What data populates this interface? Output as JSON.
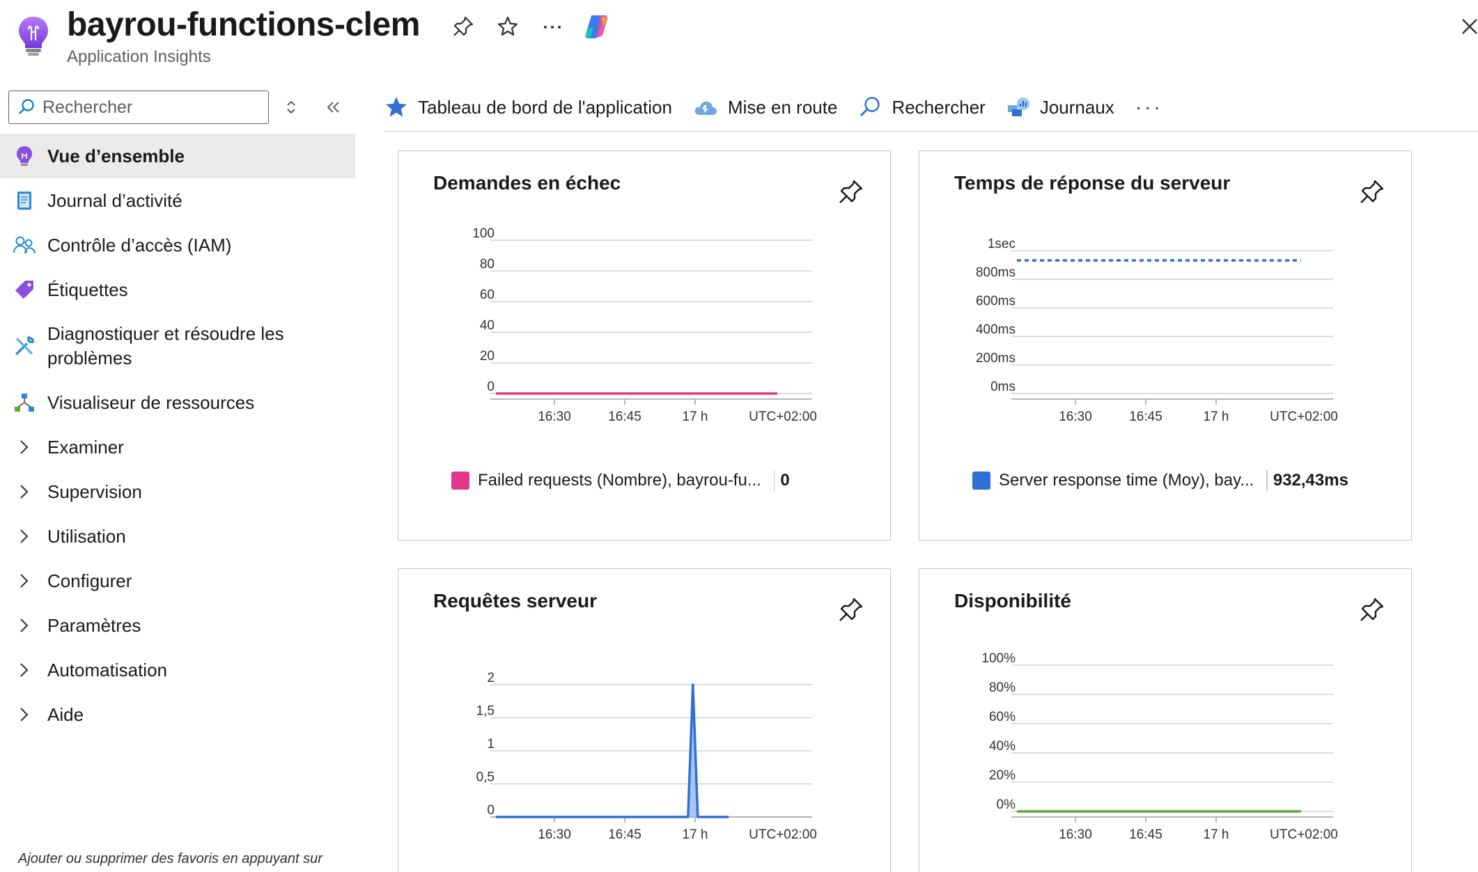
{
  "header": {
    "title": "bayrou-functions-clem",
    "subtitle": "Application Insights"
  },
  "sidebar": {
    "search_placeholder": "Rechercher",
    "items": [
      {
        "label": "Vue d’ensemble",
        "icon": "lightbulb-icon",
        "active": true
      },
      {
        "label": "Journal d’activité",
        "icon": "log-book-icon"
      },
      {
        "label": "Contrôle d’accès (IAM)",
        "icon": "people-icon"
      },
      {
        "label": "Étiquettes",
        "icon": "tag-icon"
      },
      {
        "label": "Diagnostiquer et résoudre les problèmes",
        "icon": "wrench-icon"
      },
      {
        "label": "Visualiseur de ressources",
        "icon": "hierarchy-icon"
      }
    ],
    "groups": [
      "Examiner",
      "Supervision",
      "Utilisation",
      "Configurer",
      "Paramètres",
      "Automatisation",
      "Aide"
    ],
    "footer_hint": "Ajouter ou supprimer des favoris en appuyant sur"
  },
  "toolbar": {
    "items": [
      {
        "label": "Tableau de bord de l'application",
        "icon": "star-icon"
      },
      {
        "label": "Mise en route",
        "icon": "cloud-icon"
      },
      {
        "label": "Rechercher",
        "icon": "search-icon"
      },
      {
        "label": "Journaux",
        "icon": "logs-icon"
      }
    ],
    "more": "···"
  },
  "colors": {
    "accent": "#0078d4",
    "failed": "#e3378a",
    "response": "#2f6fd6",
    "requests": "#2f6fd6",
    "availability": "#5ea72f",
    "active_bg": "#edebe9"
  },
  "chart_data": [
    {
      "type": "line",
      "title": "Demandes en échec",
      "x_ticks": [
        "16:30",
        "16:45",
        "17 h",
        "UTC+02:00"
      ],
      "y_ticks": [
        "100",
        "80",
        "60",
        "40",
        "20",
        "0"
      ],
      "ylim": [
        0,
        100
      ],
      "series": [
        {
          "name": "Failed requests (Nombre), bayrou-fu...",
          "values": [
            0,
            0,
            0,
            0,
            0,
            0,
            0,
            0,
            0,
            0,
            0
          ]
        }
      ],
      "legend_value": "0",
      "color": "#e3378a"
    },
    {
      "type": "line",
      "title": "Temps de réponse du serveur",
      "x_ticks": [
        "16:30",
        "16:45",
        "17 h",
        "UTC+02:00"
      ],
      "y_ticks": [
        "1sec",
        "800ms",
        "600ms",
        "400ms",
        "200ms",
        "0ms"
      ],
      "ylim": [
        0,
        1000
      ],
      "series": [
        {
          "name": "Server response time (Moy), bay...",
          "values": [
            932.43,
            932.43
          ]
        }
      ],
      "legend_value": "932,43ms",
      "color": "#2f6fd6"
    },
    {
      "type": "area",
      "title": "Requêtes serveur",
      "x_ticks": [
        "16:30",
        "16:45",
        "17 h",
        "UTC+02:00"
      ],
      "y_ticks": [
        "2",
        "1,5",
        "1",
        "0,5",
        "0"
      ],
      "ylim": [
        0,
        2
      ],
      "series": [
        {
          "values": [
            0,
            0,
            0,
            0,
            0,
            0,
            0,
            0,
            0,
            0,
            2,
            0,
            0
          ]
        }
      ],
      "color": "#2f6fd6"
    },
    {
      "type": "line",
      "title": "Disponibilité",
      "x_ticks": [
        "16:30",
        "16:45",
        "17 h",
        "UTC+02:00"
      ],
      "y_ticks": [
        "100%",
        "80%",
        "60%",
        "40%",
        "20%",
        "0%"
      ],
      "ylim": [
        0,
        100
      ],
      "series": [
        {
          "values": [
            0,
            0,
            0,
            0,
            0,
            0,
            0,
            0,
            0,
            0,
            0
          ]
        }
      ],
      "color": "#5ea72f"
    }
  ]
}
